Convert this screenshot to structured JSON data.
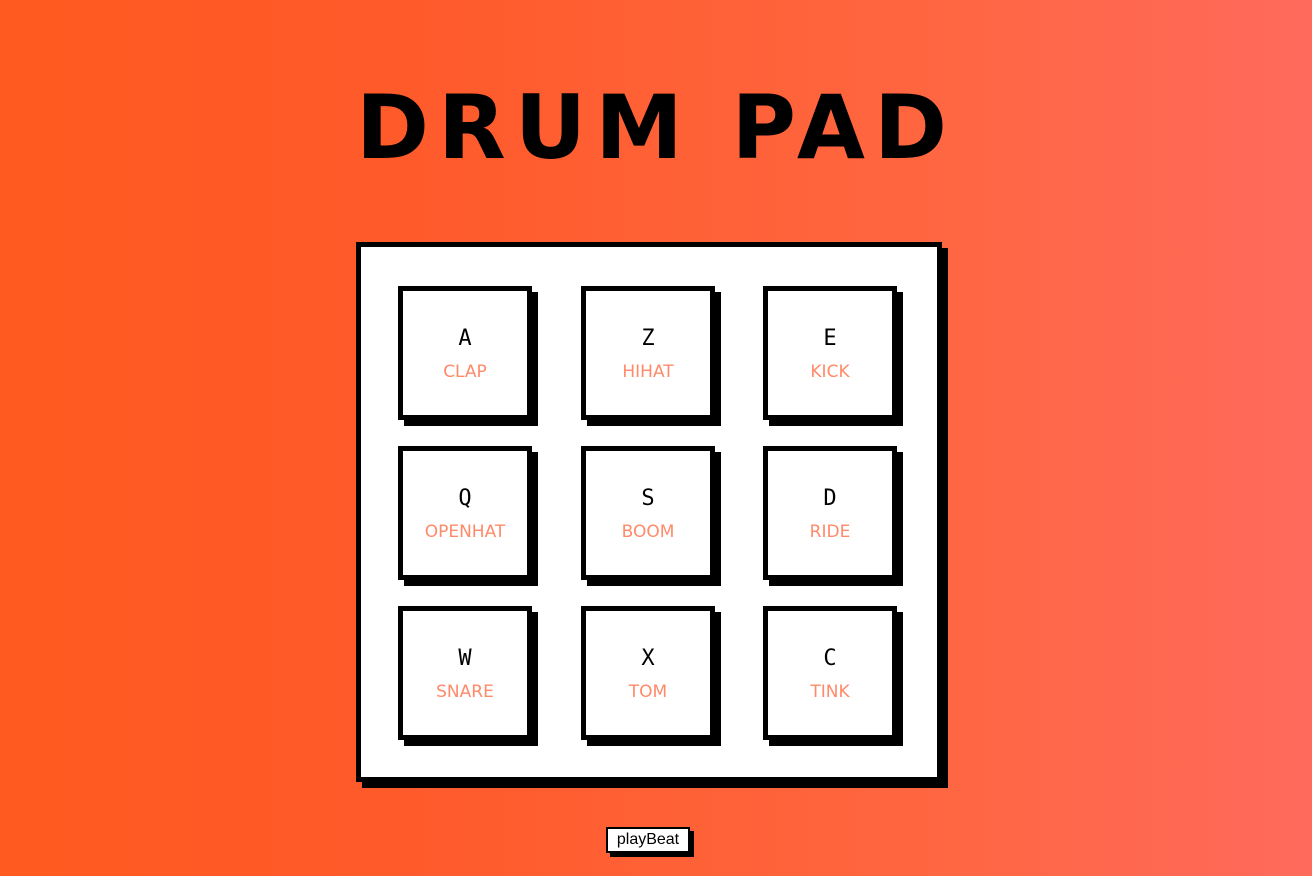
{
  "title": "DRUM PAD",
  "pads": [
    {
      "key": "A",
      "sound": "CLAP"
    },
    {
      "key": "Z",
      "sound": "HIHAT"
    },
    {
      "key": "E",
      "sound": "KICK"
    },
    {
      "key": "Q",
      "sound": "OPENHAT"
    },
    {
      "key": "S",
      "sound": "BOOM"
    },
    {
      "key": "D",
      "sound": "RIDE"
    },
    {
      "key": "W",
      "sound": "SNARE"
    },
    {
      "key": "X",
      "sound": "TOM"
    },
    {
      "key": "C",
      "sound": "TINK"
    }
  ],
  "play_button": {
    "label": "playBeat"
  },
  "colors": {
    "background_start": "#ff5a1f",
    "background_end": "#ff6a5c",
    "sound_label": "#ff8a6a",
    "pad_border": "#000000",
    "pad_fill": "#ffffff"
  }
}
